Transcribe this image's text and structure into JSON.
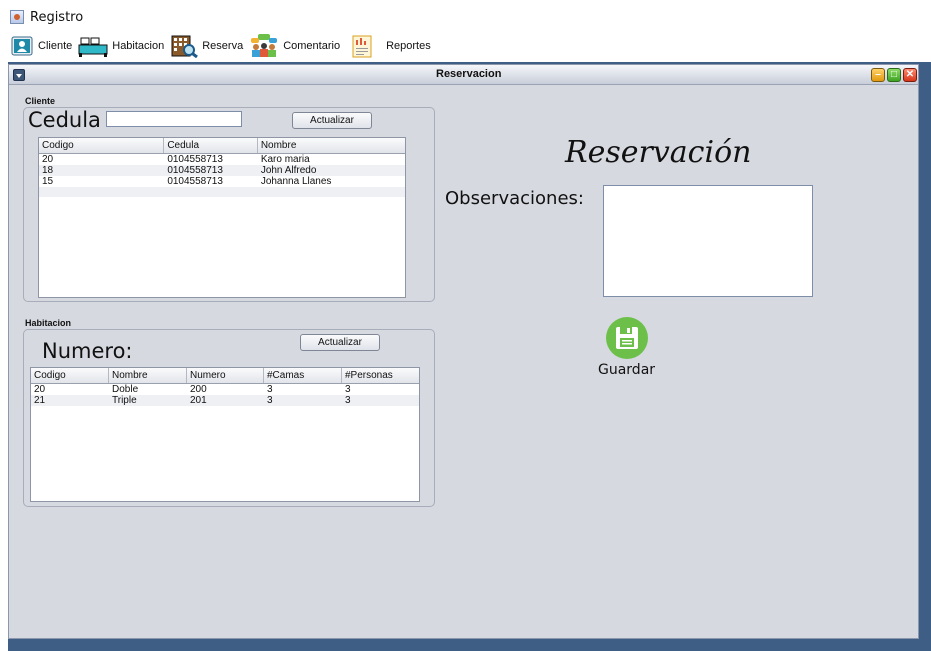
{
  "window": {
    "title": "Registro"
  },
  "menubar": {
    "items": [
      {
        "label": "Cliente",
        "icon": "user-card-icon"
      },
      {
        "label": "Habitacion",
        "icon": "bed-icon"
      },
      {
        "label": "Reserva",
        "icon": "building-search-icon"
      },
      {
        "label": "Comentario",
        "icon": "people-chat-icon"
      },
      {
        "label": "Reportes",
        "icon": "report-chart-icon"
      }
    ]
  },
  "frame": {
    "title": "Reservacion"
  },
  "cliente": {
    "group_label": "Cliente",
    "field_label": "Cedula",
    "field_value": "",
    "button": "Actualizar",
    "columns": [
      "Codigo",
      "Cedula",
      "Nombre"
    ],
    "rows": [
      [
        "20",
        "0104558713",
        "Karo maria"
      ],
      [
        "18",
        "0104558713",
        "John Alfredo"
      ],
      [
        "15",
        "0104558713",
        "Johanna Llanes"
      ]
    ]
  },
  "habitacion": {
    "group_label": "Habitacion",
    "field_label": "Numero:",
    "button": "Actualizar",
    "columns": [
      "Codigo",
      "Nombre",
      "Numero",
      "#Camas",
      "#Personas"
    ],
    "rows": [
      [
        "20",
        "Doble",
        "200",
        "3",
        "3"
      ],
      [
        "21",
        "Triple",
        "201",
        "3",
        "3"
      ]
    ]
  },
  "reservacion": {
    "title": "Reservación",
    "observaciones_label": "Observaciones:",
    "observaciones_value": "",
    "save_label": "Guardar"
  },
  "colors": {
    "desktop": "#3f5e86",
    "panel": "#d6d9e0",
    "save_green": "#6cc04a"
  }
}
